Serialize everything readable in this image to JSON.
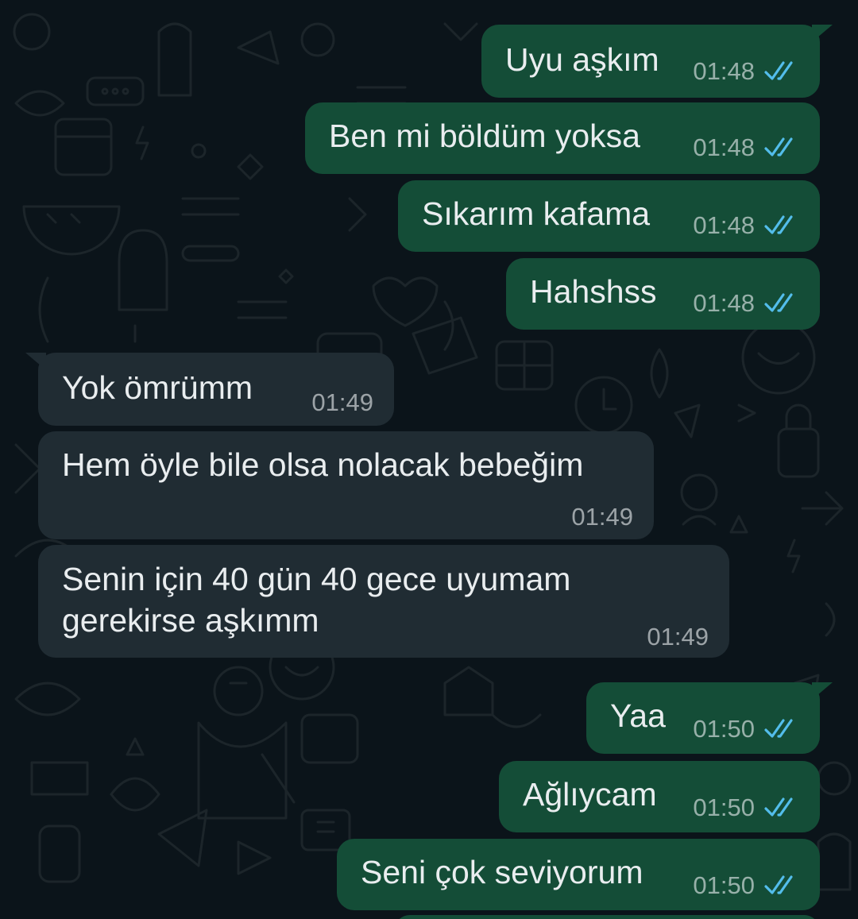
{
  "colors": {
    "background": "#0b141a",
    "outgoing_bubble": "#144d37",
    "incoming_bubble": "#202c33",
    "text": "#e9edef",
    "read_tick": "#53bdeb"
  },
  "icons": {
    "read_receipt": "double-check-icon"
  },
  "messages": [
    {
      "direction": "out",
      "text": "Uyu aşkım",
      "time": "01:48",
      "status": "read"
    },
    {
      "direction": "out",
      "text": "Ben mi böldüm yoksa",
      "time": "01:48",
      "status": "read"
    },
    {
      "direction": "out",
      "text": "Sıkarım kafama",
      "time": "01:48",
      "status": "read"
    },
    {
      "direction": "out",
      "text": "Hahshss",
      "time": "01:48",
      "status": "read"
    },
    {
      "direction": "in",
      "text": "Yok ömrümm",
      "time": "01:49"
    },
    {
      "direction": "in",
      "text": "Hem öyle bile olsa nolacak bebeğim",
      "time": "01:49"
    },
    {
      "direction": "in",
      "text_lines": [
        "Senin için 40 gün 40 gece uyumam",
        "gerekirse aşkımm"
      ],
      "time": "01:49"
    },
    {
      "direction": "out",
      "text": "Yaa",
      "time": "01:50",
      "status": "read"
    },
    {
      "direction": "out",
      "text": "Ağlıycam",
      "time": "01:50",
      "status": "read"
    },
    {
      "direction": "out",
      "text": "Seni çok seviyorum",
      "time": "01:50",
      "status": "read"
    }
  ]
}
